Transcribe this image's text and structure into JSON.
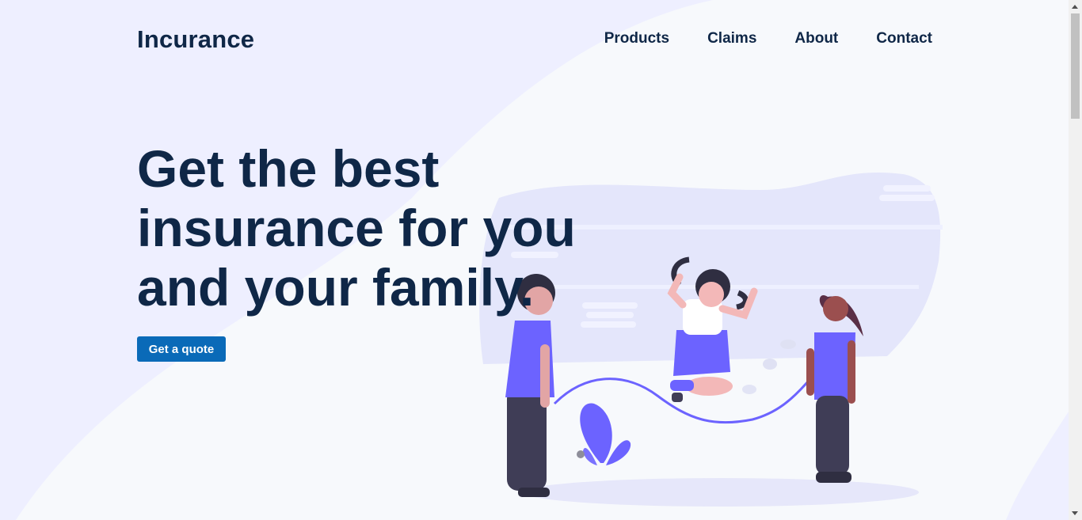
{
  "brand": "Incurance",
  "nav": {
    "items": [
      "Products",
      "Claims",
      "About",
      "Contact"
    ]
  },
  "hero": {
    "title_lines": [
      "Get the best",
      "insurance for you",
      "and your family."
    ],
    "cta_label": "Get a quote"
  },
  "colors": {
    "page_bg": "#eeefff",
    "wave": "#f7f9fc",
    "text": "#0f2747",
    "accent": "#0a6ab8",
    "illustration_purple": "#6c63ff"
  },
  "illustration": {
    "subject": "three children playing jump rope"
  }
}
